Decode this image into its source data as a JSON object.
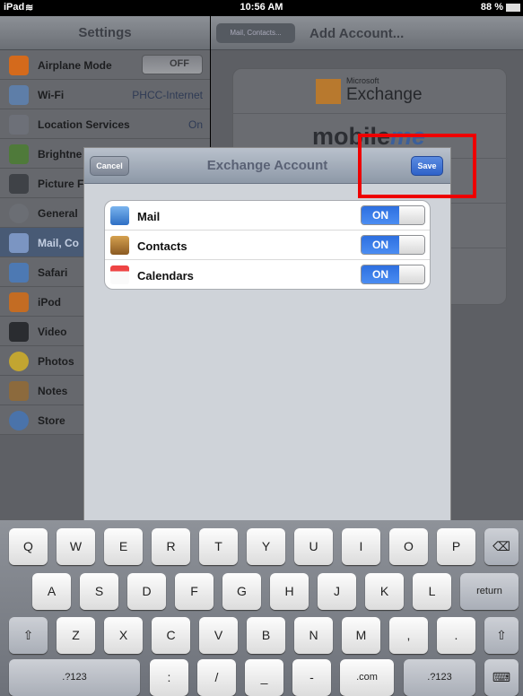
{
  "status_bar": {
    "device": "iPad",
    "time": "10:56 AM",
    "battery": "88 %"
  },
  "settings": {
    "title": "Settings",
    "rows": [
      {
        "label": "Airplane Mode",
        "value": "OFF",
        "icon": "airplane-icon"
      },
      {
        "label": "Wi-Fi",
        "value": "PHCC-Internet",
        "icon": "wifi-icon"
      },
      {
        "label": "Location Services",
        "value": "On",
        "icon": "location-icon"
      },
      {
        "label": "Brightne",
        "value": "",
        "icon": "brightness-icon"
      },
      {
        "label": "Picture F",
        "value": "",
        "icon": "picture-frame-icon"
      },
      {
        "label": "General",
        "value": "",
        "icon": "gear-icon"
      },
      {
        "label": "Mail, Co",
        "value": "",
        "icon": "mail-icon"
      },
      {
        "label": "Safari",
        "value": "",
        "icon": "safari-icon"
      },
      {
        "label": "iPod",
        "value": "",
        "icon": "ipod-icon"
      },
      {
        "label": "Video",
        "value": "",
        "icon": "video-icon"
      },
      {
        "label": "Photos",
        "value": "",
        "icon": "photos-icon"
      },
      {
        "label": "Notes",
        "value": "",
        "icon": "notes-icon"
      },
      {
        "label": "Store",
        "value": "",
        "icon": "store-icon"
      }
    ]
  },
  "detail": {
    "back_label": "Mail, Contacts...",
    "title": "Add Account...",
    "exchange_small": "Microsoft",
    "exchange_big": "Exchange",
    "mobileme_a": "mob",
    "mobileme_b": "ile",
    "mobileme_c": "me"
  },
  "modal": {
    "title": "Exchange Account",
    "cancel_label": "Cancel",
    "save_label": "Save",
    "items": [
      {
        "label": "Mail",
        "state": "ON",
        "icon": "mail-app-icon"
      },
      {
        "label": "Contacts",
        "state": "ON",
        "icon": "contacts-app-icon"
      },
      {
        "label": "Calendars",
        "state": "ON",
        "icon": "calendar-app-icon"
      }
    ]
  },
  "keyboard": {
    "row1": [
      "Q",
      "W",
      "E",
      "R",
      "T",
      "Y",
      "U",
      "I",
      "O",
      "P"
    ],
    "row2": [
      "A",
      "S",
      "D",
      "F",
      "G",
      "H",
      "J",
      "K",
      "L"
    ],
    "row3": [
      "Z",
      "X",
      "C",
      "V",
      "B",
      "N",
      "M",
      ",",
      "."
    ],
    "return_label": "return",
    "numbers_label": ".?123",
    "row4": [
      ":",
      "/",
      "_",
      "-",
      ".com"
    ],
    "icons": {
      "backspace": "backspace-icon",
      "shift": "shift-icon",
      "hide": "hide-keyboard-icon"
    }
  },
  "colors": {
    "accent": "#2e62c9",
    "highlight": "#ee0000",
    "toggle_on": "#3a7ee8"
  }
}
